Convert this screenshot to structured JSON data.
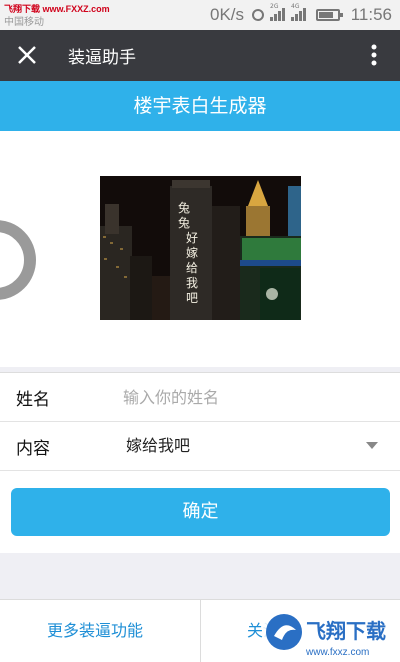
{
  "status_bar": {
    "watermark": "飞翔下载 www.FXXZ.com",
    "carrier": "中国移动",
    "network_speed": "0K/s",
    "signal_tag_1": "2G",
    "signal_tag_2": "4G",
    "time": "11:56",
    "battery_level": 0.75,
    "icons": [
      "alarm-icon",
      "signal-icon",
      "signal-icon",
      "battery-icon"
    ]
  },
  "app_bar": {
    "title": "装逼助手",
    "close_icon": "close-icon",
    "more_icon": "more-vertical-icon"
  },
  "banner": {
    "title": "楼宇表白生成器"
  },
  "preview": {
    "building_text": [
      "兔",
      "兔",
      "好",
      "嫁",
      "给",
      "我",
      "吧"
    ]
  },
  "form": {
    "name": {
      "label": "姓名",
      "placeholder": "输入你的姓名",
      "value": ""
    },
    "content": {
      "label": "内容",
      "value": "嫁给我吧"
    },
    "confirm_label": "确定"
  },
  "bottom_bar": {
    "more_label": "更多装逼功能",
    "follow_label": "关注"
  },
  "watermark_logo": {
    "text": "飞翔下载",
    "url": "www.fxxz.com"
  },
  "colors": {
    "accent": "#2fb1ea",
    "app_bar": "#393a3f",
    "link": "#1f8fd6"
  }
}
